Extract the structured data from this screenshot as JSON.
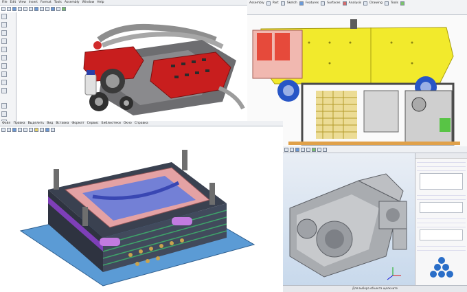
{
  "panel_tl": {
    "menu": [
      "File",
      "Edit",
      "View",
      "Insert",
      "Format",
      "Tools",
      "Assembly",
      "Window",
      "Help"
    ],
    "sidebar_label": "",
    "model": "v8-engine-assembly"
  },
  "panel_tr": {
    "ribbon_labels": [
      "Assembly",
      "Part",
      "Sketch",
      "Features",
      "Surfaces",
      "Analysis",
      "Drawing",
      "Tools"
    ],
    "model": "underwater-vehicle-frame"
  },
  "panel_bl": {
    "menu": [
      "Файл",
      "Правка",
      "Выделить",
      "Вид",
      "Вставка",
      "Формат",
      "Сервис",
      "Библиотеки",
      "Окно",
      "Справка"
    ],
    "model": "injection-mold-tool"
  },
  "panel_br": {
    "model": "gearbox-housing",
    "status": "Для выбора объекта щелкните"
  },
  "colors": {
    "engine_red": "#c81e1e",
    "frame_yellow": "#f2ea2c",
    "mold_base": "#5b9bd5",
    "viewport_bg_light": "#ffffff",
    "viewport_bg_blue": "#c8d9ec"
  }
}
